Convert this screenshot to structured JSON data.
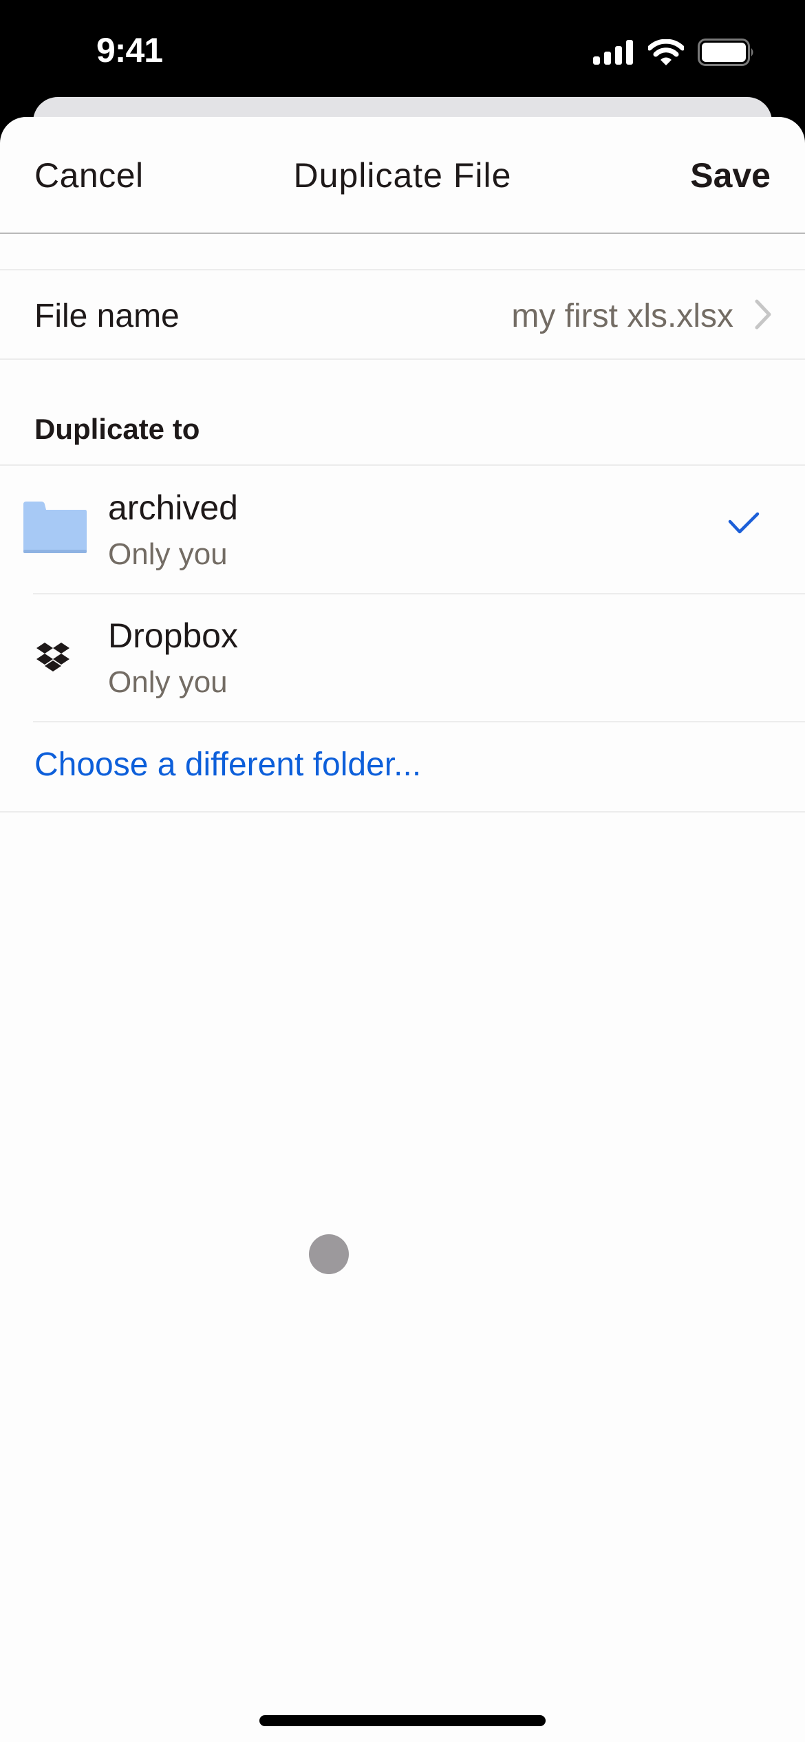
{
  "status_bar": {
    "time": "9:41",
    "icons": [
      "cellular-signal-icon",
      "wifi-icon",
      "battery-icon"
    ]
  },
  "nav": {
    "cancel_label": "Cancel",
    "title": "Duplicate File",
    "save_label": "Save"
  },
  "file_name": {
    "label": "File name",
    "value": "my first xls.xlsx",
    "icon": "chevron-right-icon"
  },
  "destination": {
    "section_title": "Duplicate to",
    "items": [
      {
        "name": "archived",
        "subtitle": "Only you",
        "icon": "folder-icon",
        "selected": true
      },
      {
        "name": "Dropbox",
        "subtitle": "Only you",
        "icon": "dropbox-logo-icon",
        "selected": false
      }
    ],
    "choose_label": "Choose a different folder..."
  },
  "colors": {
    "accent": "#0d5fda",
    "folder": "#a7c9f5",
    "text_primary": "#1e1919",
    "text_secondary": "#736c64"
  }
}
